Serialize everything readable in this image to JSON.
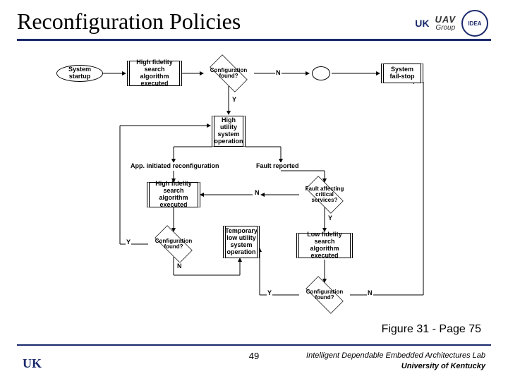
{
  "title": "Reconfiguration Policies",
  "logos": {
    "uk": "UK",
    "uav_main": "UAV",
    "uav_sub": "Group",
    "idea": "IDEA"
  },
  "nodes": {
    "startup": "System startup",
    "hf1": "High fidelity search algorithm executed",
    "cfg1": "Configuration found?",
    "n1": "N",
    "failstop": "System fail-stop",
    "y1": "Y",
    "highop": "High utility system operation",
    "appinit": "App. initiated reconfiguration",
    "faultrep": "Fault reported",
    "hf2": "High fidelity search algorithm executed",
    "faultaff": "Fault affecting critical services?",
    "n2": "N",
    "cfg2": "Configuration found?",
    "y2": "Y",
    "y3": "Y",
    "n3": "N",
    "temp": "Temporary low utility system operation",
    "lowfid": "Low fidelity search algorithm executed",
    "cfg3": "Configuration found?",
    "y4": "Y",
    "n4": "N"
  },
  "caption": "Figure 31 - Page 75",
  "footer": {
    "uk": "UK",
    "page": "49",
    "lab1": "Intelligent Dependable Embedded Architectures Lab",
    "lab2": "University of Kentucky"
  }
}
